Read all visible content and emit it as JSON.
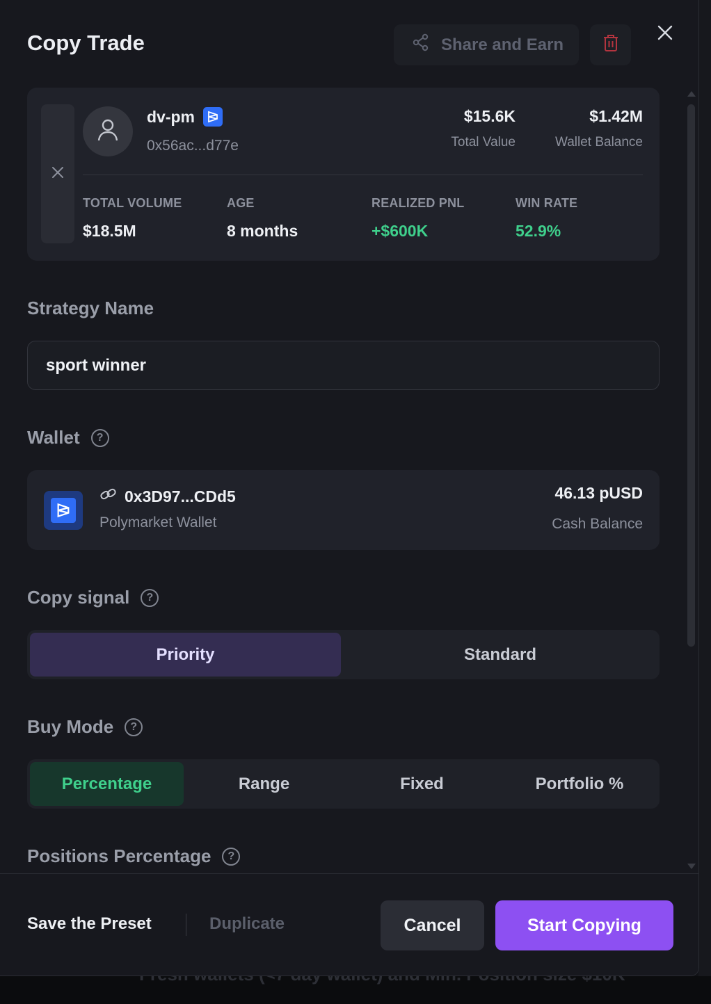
{
  "modal": {
    "title": "Copy Trade",
    "share_label": "Share and Earn",
    "icons": [
      "share-icon",
      "trash-icon",
      "close-icon"
    ]
  },
  "trader": {
    "name": "dv-pm",
    "address": "0x56ac...d77e",
    "total_value": "$15.6K",
    "total_value_label": "Total Value",
    "wallet_balance": "$1.42M",
    "wallet_balance_label": "Wallet Balance",
    "metrics": [
      {
        "label": "TOTAL VOLUME",
        "value": "$18.5M"
      },
      {
        "label": "AGE",
        "value": "8 months"
      },
      {
        "label": "REALIZED PNL",
        "value": "+$600K"
      },
      {
        "label": "WIN RATE",
        "value": "52.9%"
      }
    ]
  },
  "strategy": {
    "label": "Strategy Name",
    "value": "sport winner"
  },
  "wallet": {
    "label": "Wallet",
    "address": "0x3D97...CDd5",
    "type": "Polymarket Wallet",
    "balance": "46.13 pUSD",
    "balance_label": "Cash Balance"
  },
  "copy_signal": {
    "label": "Copy signal",
    "options": [
      "Priority",
      "Standard"
    ],
    "selected": "Priority"
  },
  "buy_mode": {
    "label": "Buy Mode",
    "options": [
      "Percentage",
      "Range",
      "Fixed",
      "Portfolio %"
    ],
    "selected": "Percentage"
  },
  "positions": {
    "label": "Positions Percentage"
  },
  "footer": {
    "save_preset": "Save the Preset",
    "duplicate": "Duplicate",
    "cancel": "Cancel",
    "start": "Start Copying"
  },
  "background": {
    "partial_text": "Fresh wallets (<7 day wallet) and Min. Position size $10K"
  },
  "colors": {
    "accent_purple": "#8d50f2",
    "positive_green": "#3fd08c",
    "polymarket_blue": "#2f6df6",
    "danger_red": "#b3343f"
  }
}
